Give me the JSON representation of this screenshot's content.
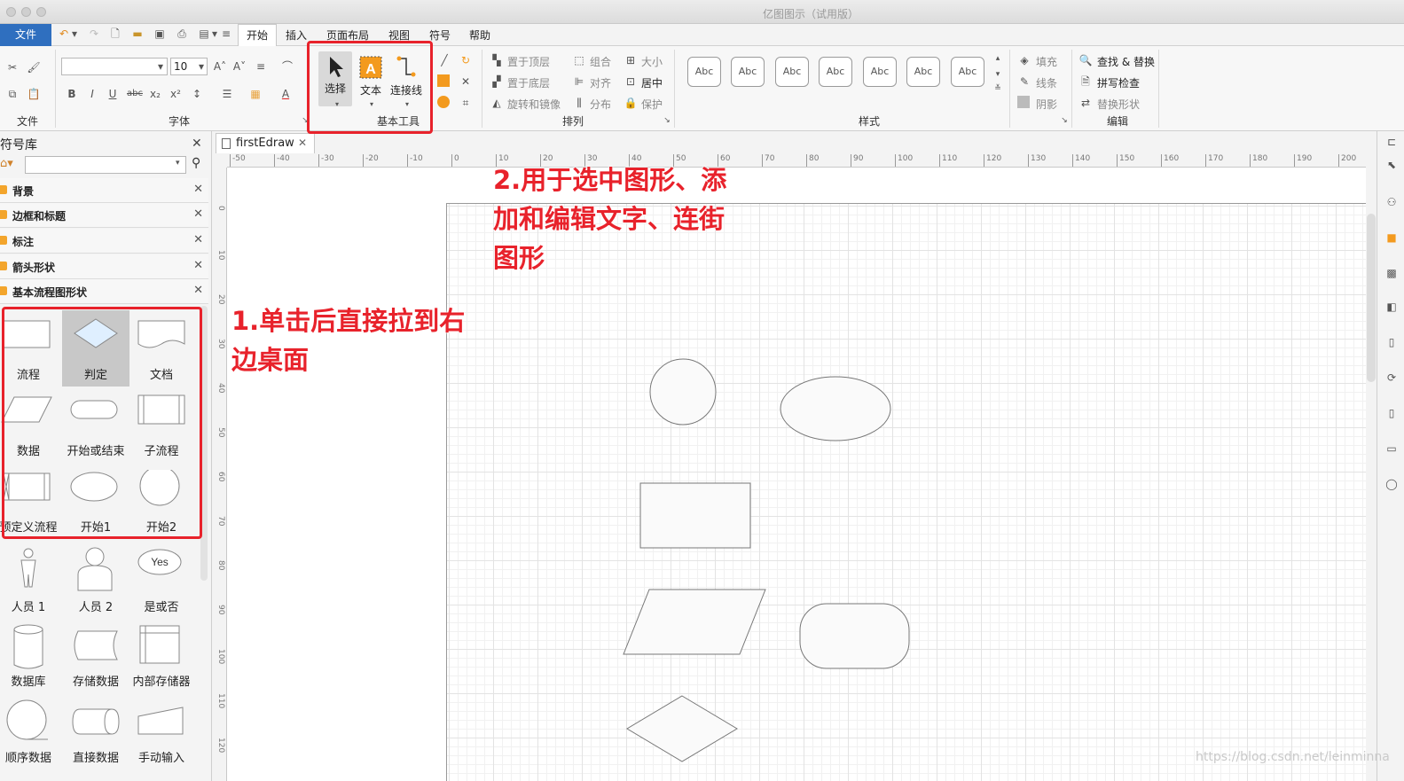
{
  "window": {
    "title": "亿图图示（试用版）"
  },
  "menu": {
    "file": "文件",
    "tabs": [
      "开始",
      "插入",
      "页面布局",
      "视图",
      "符号",
      "帮助"
    ],
    "active_tab": "开始"
  },
  "ribbon": {
    "file_group": {
      "label": "文件"
    },
    "font_group": {
      "label": "字体",
      "font_name": "",
      "font_size": "10"
    },
    "basic_tools": {
      "label": "基本工具",
      "select": "选择",
      "text": "文本",
      "connector": "连接线"
    },
    "arrange": {
      "label": "排列",
      "bring_front": "置于顶层",
      "send_back": "置于底层",
      "rotate": "旋转和镜像",
      "group": "组合",
      "align": "对齐",
      "distribute": "分布",
      "size": "大小",
      "center": "居中",
      "protect": "保护"
    },
    "style": {
      "label": "样式",
      "swatches": [
        "Abc",
        "Abc",
        "Abc",
        "Abc",
        "Abc",
        "Abc",
        "Abc"
      ]
    },
    "fill_line": {
      "fill": "填充",
      "line": "线条",
      "shadow": "阴影"
    },
    "edit": {
      "label": "编辑",
      "find_replace": "查找 & 替换",
      "spell_check": "拼写检查",
      "replace_shape": "替换形状"
    }
  },
  "symbol_library": {
    "title": "符号库",
    "search_placeholder": "",
    "categories": [
      "背景",
      "边框和标题",
      "标注",
      "箭头形状",
      "基本流程图形状"
    ],
    "shapes": [
      "流程",
      "判定",
      "文档",
      "数据",
      "开始或结束",
      "子流程",
      "预定义流程",
      "开始1",
      "开始2",
      "人员 1",
      "人员 2",
      "是或否",
      "数据库",
      "存储数据",
      "内部存储器",
      "顺序数据",
      "直接数据",
      "手动输入"
    ],
    "yes_label": "Yes"
  },
  "document": {
    "tab": "firstEdraw"
  },
  "ruler": {
    "h_ticks": [
      "-50",
      "-40",
      "-30",
      "-20",
      "-10",
      "0",
      "10",
      "20",
      "30",
      "40",
      "50",
      "60",
      "70",
      "80",
      "90",
      "100",
      "110",
      "120",
      "130",
      "140",
      "150",
      "160",
      "170",
      "180",
      "190",
      "200"
    ],
    "v_ticks": [
      "0",
      "10",
      "20",
      "30",
      "40",
      "50",
      "60",
      "70",
      "80",
      "90",
      "100",
      "110",
      "120"
    ]
  },
  "annotations": {
    "note1_line1": "1.单击后直接拉到右",
    "note1_line2": "边桌面",
    "note2_line1": "2.用于选中图形、添",
    "note2_line2": "加和编辑文字、连街",
    "note2_line3": "图形"
  },
  "watermark": "https://blog.csdn.net/leinminna",
  "colors": {
    "accent": "#2f6fbf",
    "annotation": "#e8222b",
    "tool_orange": "#f39a1e"
  }
}
